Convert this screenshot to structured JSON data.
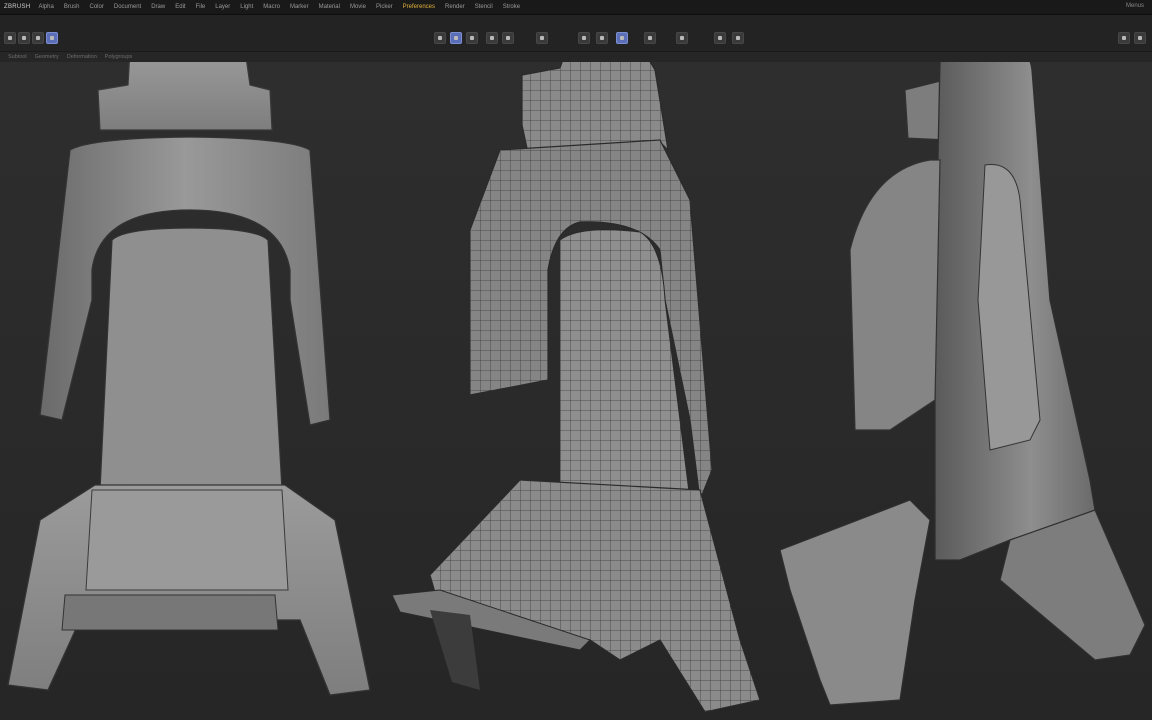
{
  "menubar": {
    "logo": "ZBRUSH",
    "items": [
      "Alpha",
      "Brush",
      "Color",
      "Document",
      "Draw",
      "Edit",
      "File",
      "Layer",
      "Light",
      "Macro",
      "Marker",
      "Material",
      "Movie",
      "Picker",
      "Preferences",
      "Render",
      "Stencil",
      "Stroke"
    ],
    "active_index": 14,
    "right_label": "Menus"
  },
  "subbar": {
    "items": [
      "Subtool",
      "Geometry",
      "Deformation",
      "Polygroups"
    ]
  },
  "colors": {
    "accent": "#5b6fb8",
    "active_menu": "#e0b13a",
    "background": "#2b2b2b",
    "model": "#8a8a8a"
  },
  "icons": [
    "move-icon",
    "scale-icon",
    "rotate-icon",
    "draw-icon",
    "frame-icon",
    "persp-icon",
    "floor-icon",
    "local-icon",
    "xyz-icon",
    "polyf-icon",
    "transp-icon",
    "solo-icon"
  ]
}
